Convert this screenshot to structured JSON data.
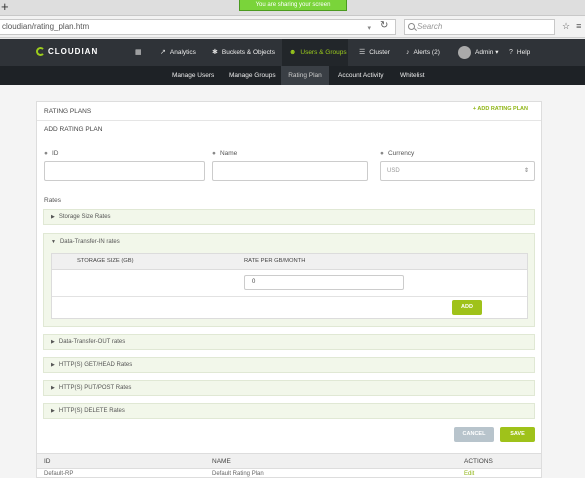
{
  "browser": {
    "share_banner": "You are sharing your screen",
    "url": "cloudian/rating_plan.htm",
    "search_placeholder": "Search"
  },
  "header": {
    "logo": "CLOUDIAN",
    "nav": [
      {
        "label": "Analytics",
        "icon": "chart-icon"
      },
      {
        "label": "Buckets & Objects",
        "icon": "gear-icon"
      },
      {
        "label": "Users & Groups",
        "icon": "users-icon",
        "active": true
      },
      {
        "label": "Cluster",
        "icon": "server-icon"
      },
      {
        "label": "Alerts (2)",
        "icon": "bell-icon"
      },
      {
        "label": "Admin ▾",
        "icon": "avatar"
      },
      {
        "label": "Help",
        "icon": "help-icon"
      }
    ],
    "subnav": [
      {
        "label": "Manage Users"
      },
      {
        "label": "Manage Groups"
      },
      {
        "label": "Rating Plan",
        "active": true
      },
      {
        "label": "Account Activity"
      },
      {
        "label": "Whitelist"
      }
    ]
  },
  "panel": {
    "title": "RATING PLANS",
    "add_link": "+ ADD RATING PLAN",
    "subtitle": "ADD RATING PLAN",
    "fields": {
      "id_label": "ID",
      "id_value": "",
      "name_label": "Name",
      "name_value": "",
      "currency_label": "Currency",
      "currency_value": "USD"
    },
    "rates_label": "Rates",
    "accordions": {
      "storage": "Storage Size Rates",
      "transfer_in": "Data-Transfer-IN rates",
      "transfer_out": "Data-Transfer-OUT rates",
      "get_head": "HTTP(S) GET/HEAD Rates",
      "put_post": "HTTP(S) PUT/POST Rates",
      "delete": "HTTP(S) DELETE Rates"
    },
    "transfer_in_table": {
      "col_storage": "STORAGE SIZE (GB)",
      "col_rate": "RATE PER GB/MONTH",
      "rate_value": "0",
      "add_button": "ADD"
    },
    "cancel_button": "CANCEL",
    "save_button": "SAVE",
    "list": {
      "col_id": "ID",
      "col_name": "NAME",
      "col_actions": "ACTIONS",
      "rows": [
        {
          "id": "Default-RP",
          "name": "Default Rating Plan",
          "action": "Edit"
        }
      ]
    }
  }
}
